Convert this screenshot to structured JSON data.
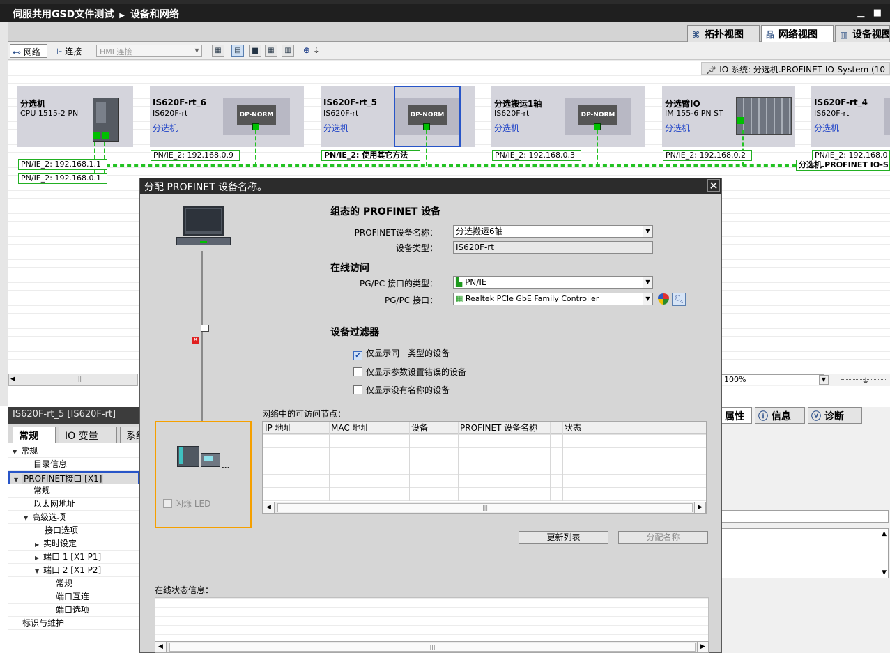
{
  "window": {
    "project": "伺服共用GSD文件测试",
    "section": "设备和网络",
    "controls": "▁ ■"
  },
  "view_tabs": [
    {
      "label": "拓扑视图",
      "icon": "topology-icon"
    },
    {
      "label": "网络视图",
      "icon": "network-view-icon",
      "active": true
    },
    {
      "label": "设备视图",
      "icon": "device-view-icon"
    }
  ],
  "toolbar": {
    "network_label": "网络",
    "connect_label": "连接",
    "hmi_select": "HMI 连接",
    "zoom_label": "⊕"
  },
  "canvas": {
    "io_system": "IO 系统: 分选机.PROFINET IO-System (10",
    "devices": [
      {
        "name": "分选机",
        "type": "CPU 1515-2 PN",
        "controller": ""
      },
      {
        "name": "IS620F-rt_6",
        "type": "IS620F-rt",
        "controller": "分选机"
      },
      {
        "name": "IS620F-rt_5",
        "type": "IS620F-rt",
        "controller": "分选机"
      },
      {
        "name": "分选搬运1轴",
        "type": "IS620F-rt",
        "controller": "分选机"
      },
      {
        "name": "分选臂IO",
        "type": "IM 155-6 PN ST",
        "controller": "分选机"
      },
      {
        "name": "IS620F-rt_4",
        "type": "IS620F-rt",
        "controller": "分选机"
      }
    ],
    "dp_norm": "DP-NORM",
    "ip_labels": [
      "PN/IE_2:  192.168.1.1",
      "PN/IE_2:  192.168.0.1",
      "PN/IE_2:  192.168.0.9",
      "PN/IE_2:  使用其它方法",
      "PN/IE_2:  192.168.0.3",
      "PN/IE_2:  192.168.0.2",
      "PN/IE_2:  192.168.0"
    ],
    "bus_label": "分选机.PROFINET IO-Sy",
    "zoom": "100%"
  },
  "properties": {
    "header": "IS620F-rt_5 [IS620F-rt]",
    "tabs": [
      "常规",
      "IO 变量",
      "系统"
    ],
    "tree": [
      {
        "label": "常规",
        "level": 0,
        "arrow": "▼"
      },
      {
        "label": "目录信息",
        "level": 1,
        "arrow": ""
      },
      {
        "label": "PROFINET接口 [X1]",
        "level": 0,
        "arrow": "▼",
        "selected": true
      },
      {
        "label": "常规",
        "level": 1,
        "arrow": ""
      },
      {
        "label": "以太网地址",
        "level": 1,
        "arrow": ""
      },
      {
        "label": "高级选项",
        "level": 1,
        "arrow": "▼"
      },
      {
        "label": "接口选项",
        "level": 2,
        "arrow": ""
      },
      {
        "label": "实时设定",
        "level": 2,
        "arrow": "▶"
      },
      {
        "label": "端口 1 [X1 P1]",
        "level": 2,
        "arrow": "▶"
      },
      {
        "label": "端口 2 [X1 P2]",
        "level": 2,
        "arrow": "▼"
      },
      {
        "label": "常规",
        "level": 3,
        "arrow": ""
      },
      {
        "label": "端口互连",
        "level": 3,
        "arrow": ""
      },
      {
        "label": "端口选项",
        "level": 3,
        "arrow": ""
      },
      {
        "label": "标识与维护",
        "level": 0,
        "arrow": ""
      }
    ]
  },
  "right_panel": {
    "tabs": [
      "属性",
      "信息",
      "诊断"
    ]
  },
  "dialog": {
    "title": "分配 PROFINET 设备名称。",
    "close": "✕",
    "section_configured": "组态的 PROFINET 设备",
    "device_name_label": "PROFINET设备名称：",
    "device_name_value": "分选搬运6轴",
    "device_type_label": "设备类型：",
    "device_type_value": "IS620F-rt",
    "section_online": "在线访问",
    "pgpc_type_label": "PG/PC 接口的类型：",
    "pgpc_type_value": "PN/IE",
    "pgpc_iface_label": "PG/PC 接口：",
    "pgpc_iface_value": "Realtek PCIe GbE Family Controller",
    "section_filter": "设备过滤器",
    "filters": [
      {
        "label": "仅显示同一类型的设备",
        "checked": true
      },
      {
        "label": "仅显示参数设置错误的设备",
        "checked": false
      },
      {
        "label": "仅显示没有名称的设备",
        "checked": false
      }
    ],
    "nodes_label": "网络中的可访问节点：",
    "columns": [
      "IP 地址",
      "MAC 地址",
      "设备",
      "PROFINET 设备名称",
      "状态"
    ],
    "flash_led": "闪烁 LED",
    "btn_update": "更新列表",
    "btn_assign": "分配名称",
    "status_label": "在线状态信息："
  },
  "colors": {
    "bus": "#23c223",
    "selection": "#2855c8",
    "highlight": "#f5a000"
  }
}
